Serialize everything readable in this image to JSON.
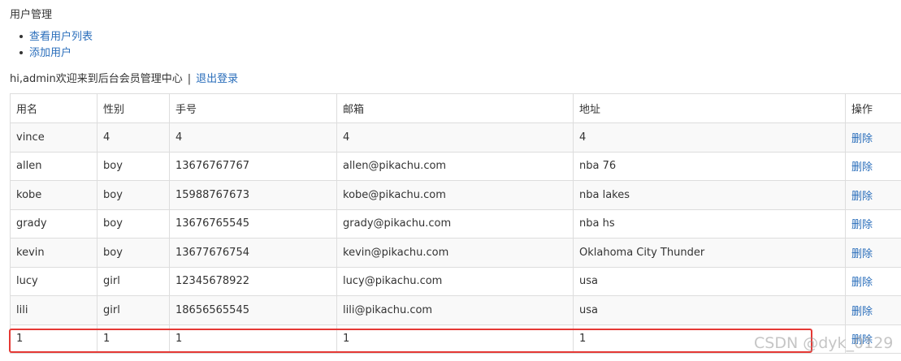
{
  "section": {
    "title": "用户管理"
  },
  "nav": {
    "items": [
      {
        "label": "查看用户列表"
      },
      {
        "label": "添加用户"
      }
    ]
  },
  "welcome": {
    "text": "hi,admin欢迎来到后台会员管理中心",
    "separator": "|",
    "logout_label": "退出登录"
  },
  "table": {
    "headers": [
      "用名",
      "性别",
      "手号",
      "邮箱",
      "地址",
      "操作"
    ],
    "rows": [
      {
        "name": "vince",
        "gender": "4",
        "phone": "4",
        "email": "4",
        "address": "4",
        "action": "删除"
      },
      {
        "name": "allen",
        "gender": "boy",
        "phone": "13676767767",
        "email": "allen@pikachu.com",
        "address": "nba 76",
        "action": "删除"
      },
      {
        "name": "kobe",
        "gender": "boy",
        "phone": "15988767673",
        "email": "kobe@pikachu.com",
        "address": "nba lakes",
        "action": "删除"
      },
      {
        "name": "grady",
        "gender": "boy",
        "phone": "13676765545",
        "email": "grady@pikachu.com",
        "address": "nba hs",
        "action": "删除"
      },
      {
        "name": "kevin",
        "gender": "boy",
        "phone": "13677676754",
        "email": "kevin@pikachu.com",
        "address": "Oklahoma City Thunder",
        "action": "删除"
      },
      {
        "name": "lucy",
        "gender": "girl",
        "phone": "12345678922",
        "email": "lucy@pikachu.com",
        "address": "usa",
        "action": "删除"
      },
      {
        "name": "lili",
        "gender": "girl",
        "phone": "18656565545",
        "email": "lili@pikachu.com",
        "address": "usa",
        "action": "删除"
      },
      {
        "name": "1",
        "gender": "1",
        "phone": "1",
        "email": "1",
        "address": "1",
        "action": "删除"
      }
    ]
  },
  "watermark": {
    "text": "CSDN @dyk_0129"
  },
  "colors": {
    "link": "#2a6ebb",
    "border": "#dddddd",
    "highlight": "#e53935"
  }
}
